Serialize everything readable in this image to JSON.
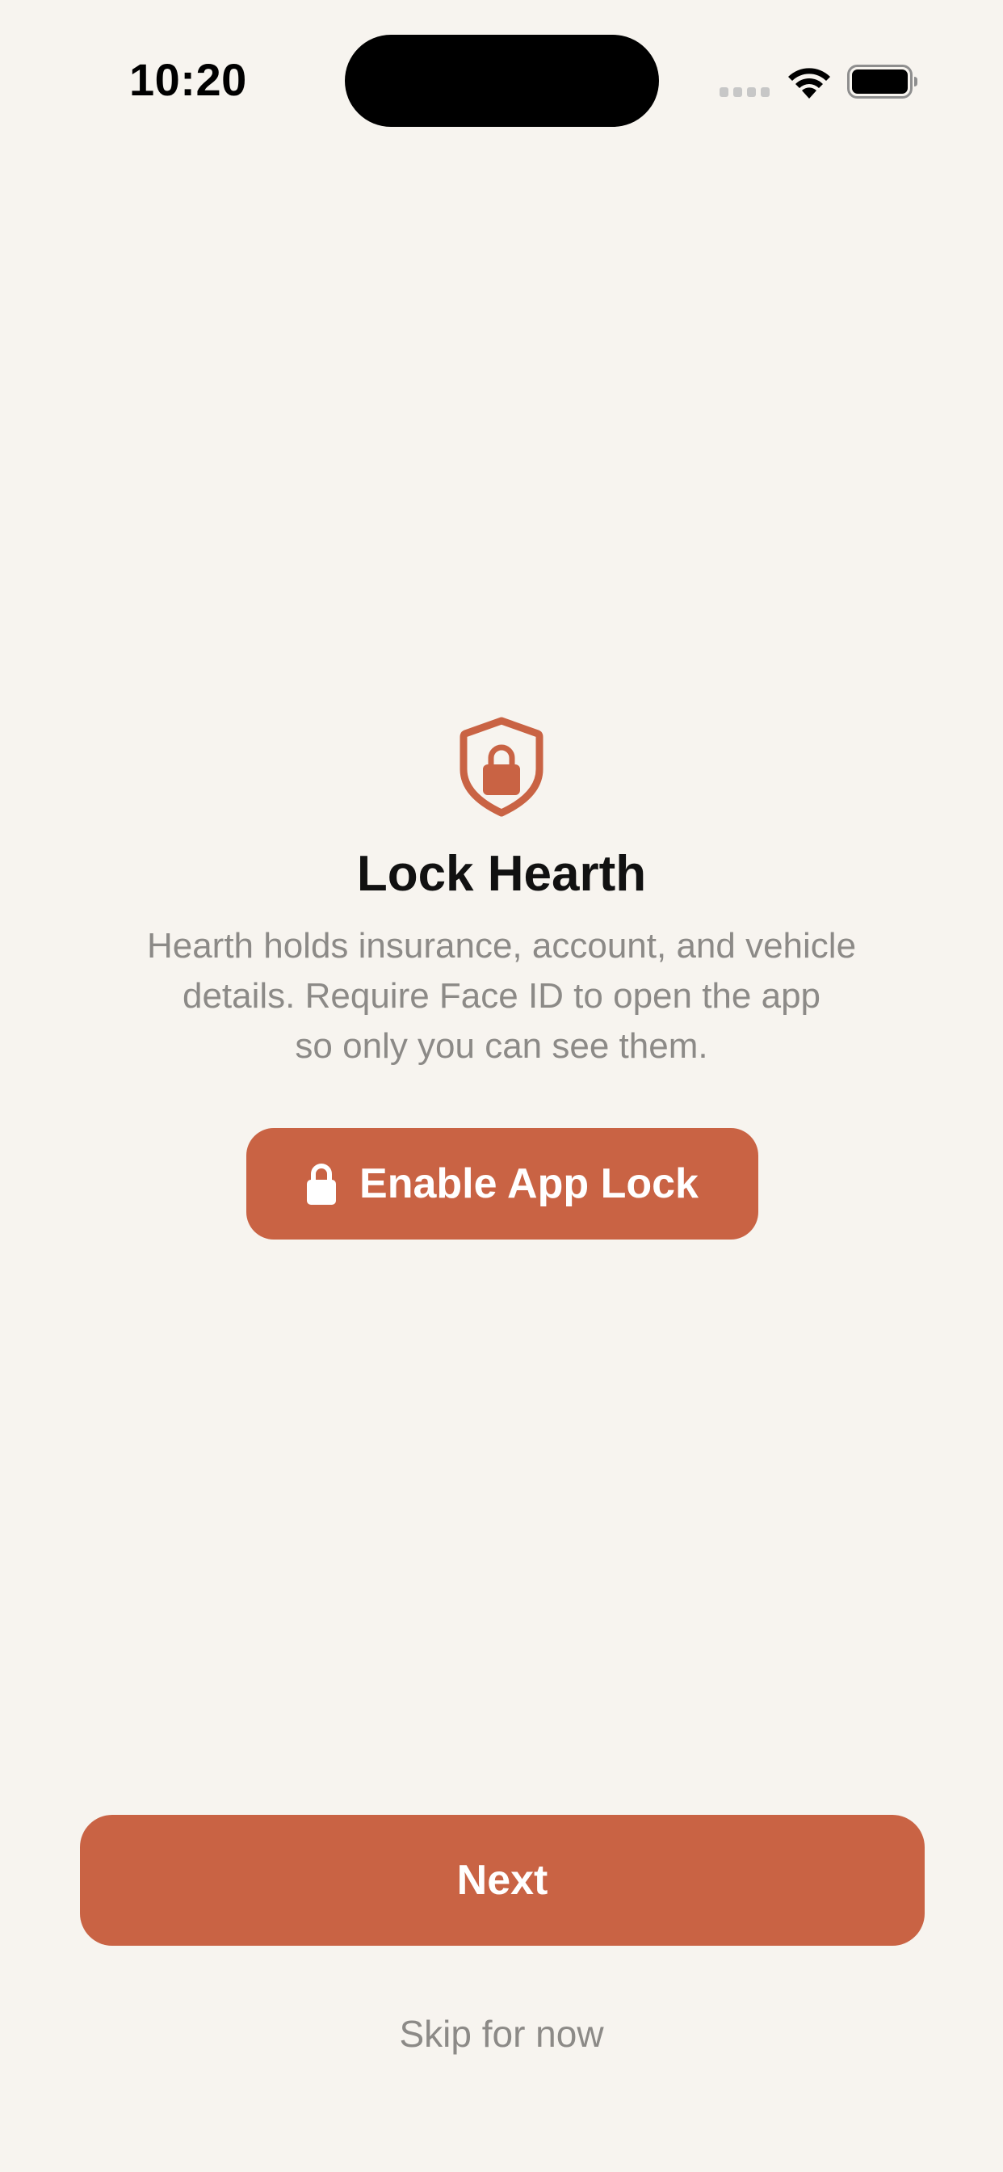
{
  "status_bar": {
    "time": "10:20"
  },
  "icons": {
    "shield": "lock-shield-icon",
    "button_lock": "lock-icon",
    "wifi": "wifi-icon",
    "battery": "battery-icon",
    "signal": "signal-icon"
  },
  "colors": {
    "accent": "#C96344",
    "background": "#F7F4EF",
    "secondary_text": "#8C8A87"
  },
  "main": {
    "title": "Lock Hearth",
    "description_lines": [
      "Hearth holds insurance, account, and vehicle",
      "details. Require Face ID to open the app",
      "so only you can see them."
    ],
    "enable_button_label": "Enable App Lock"
  },
  "footer": {
    "next_label": "Next",
    "skip_label": "Skip for now"
  }
}
